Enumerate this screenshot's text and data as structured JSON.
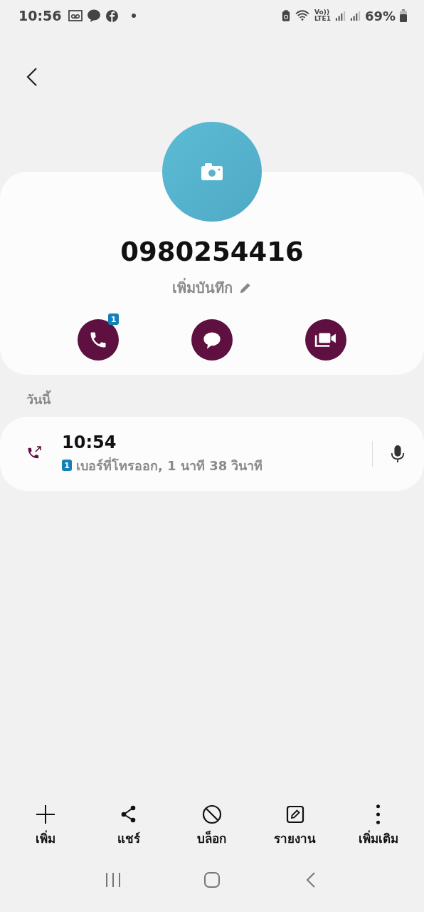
{
  "status_bar": {
    "time": "10:56",
    "network_labels": [
      "Vo))",
      "LTE1"
    ],
    "battery": "69%"
  },
  "contact": {
    "number": "0980254416",
    "note_label": "เพิ่มบันทึก",
    "actions": [
      {
        "kind": "call",
        "badge": "1"
      },
      {
        "kind": "message"
      },
      {
        "kind": "video"
      }
    ]
  },
  "section_title": "วันนี้",
  "call_log": [
    {
      "kind": "outgoing",
      "time": "10:54",
      "sim": "1",
      "detail": "เบอร์ที่โทรออก, 1 นาที 38 วินาที"
    }
  ],
  "bottom_actions": [
    {
      "kind": "add",
      "label": "เพิ่ม"
    },
    {
      "kind": "share",
      "label": "แชร์"
    },
    {
      "kind": "block",
      "label": "บล็อก"
    },
    {
      "kind": "report",
      "label": "รายงาน"
    },
    {
      "kind": "more",
      "label": "เพิ่มเติม"
    }
  ]
}
